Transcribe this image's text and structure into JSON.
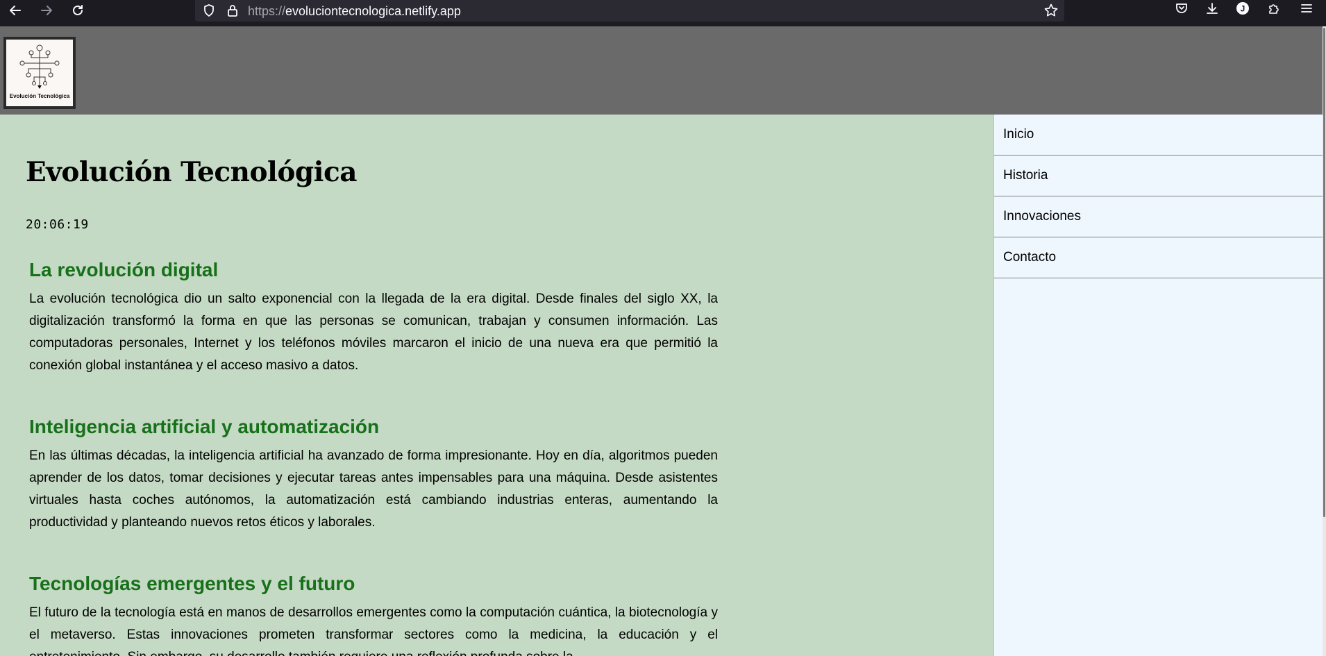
{
  "browser": {
    "url_protocol": "https://",
    "url_domain": "evoluciontecnologica.netlify.app",
    "profile_initial": "J"
  },
  "header": {
    "logo_text": "Evolución Tecnológica"
  },
  "main": {
    "title": "Evolución Tecnológica",
    "clock": "20:06:19",
    "sections": [
      {
        "heading": "La revolución digital",
        "body": "La evolución tecnológica dio un salto exponencial con la llegada de la era digital. Desde finales del siglo XX, la digitalización transformó la forma en que las personas se comunican, trabajan y consumen información. Las computadoras personales, Internet y los teléfonos móviles marcaron el inicio de una nueva era que permitió la conexión global instantánea y el acceso masivo a datos."
      },
      {
        "heading": "Inteligencia artificial y automatización",
        "body": "En las últimas décadas, la inteligencia artificial ha avanzado de forma impresionante. Hoy en día, algoritmos pueden aprender de los datos, tomar decisiones y ejecutar tareas antes impensables para una máquina. Desde asistentes virtuales hasta coches autónomos, la automatización está cambiando industrias enteras, aumentando la productividad y planteando nuevos retos éticos y laborales."
      },
      {
        "heading": "Tecnologías emergentes y el futuro",
        "body": "El futuro de la tecnología está en manos de desarrollos emergentes como la computación cuántica, la biotecnología y el metaverso. Estas innovaciones prometen transformar sectores como la medicina, la educación y el entretenimiento. Sin embargo, su desarrollo también requiere una reflexión profunda sobre la"
      }
    ]
  },
  "sidebar": {
    "items": [
      {
        "label": "Inicio"
      },
      {
        "label": "Historia"
      },
      {
        "label": "Innovaciones"
      },
      {
        "label": "Contacto"
      }
    ]
  },
  "colors": {
    "content_bg": "#c5dac5",
    "header_bg": "#6a6a6a",
    "heading_green": "#17701a",
    "sidebar_bg": "#eff7fe",
    "browser_bg": "#1c1b22"
  },
  "icons": [
    "back-arrow-icon",
    "forward-arrow-icon",
    "reload-icon",
    "shield-icon",
    "lock-icon",
    "star-icon",
    "pocket-icon",
    "download-icon",
    "account-icon",
    "extensions-icon",
    "menu-icon"
  ]
}
